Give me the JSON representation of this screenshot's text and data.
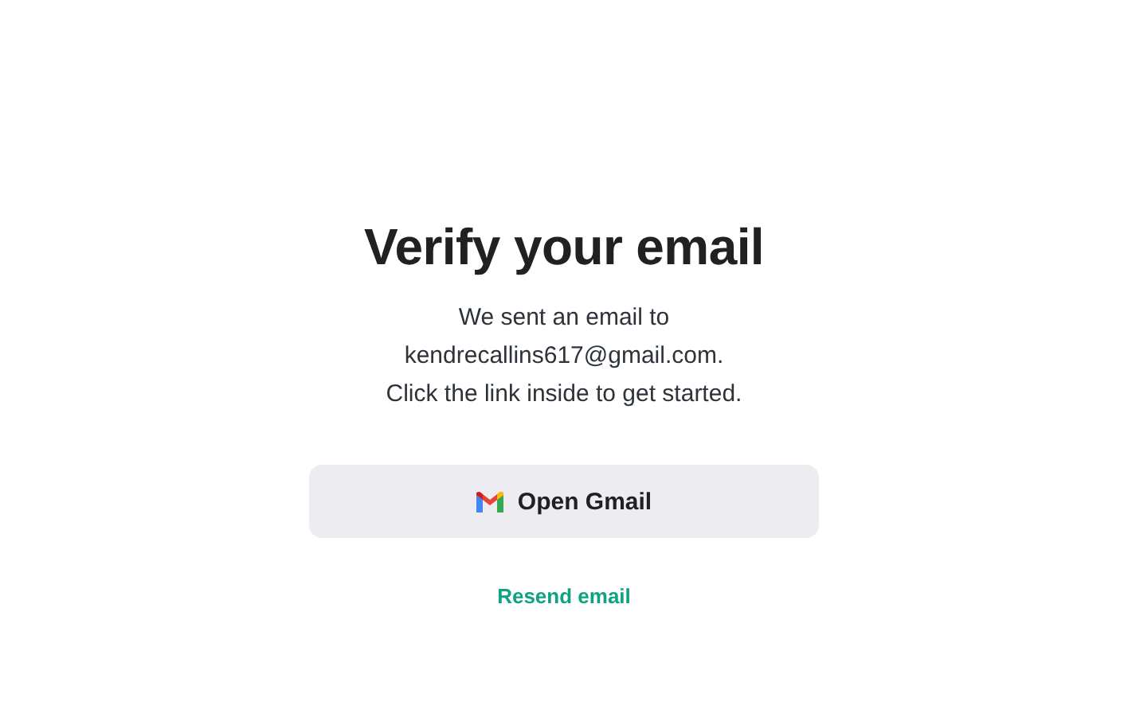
{
  "title": "Verify your email",
  "message_lines": [
    "We sent an email to",
    "kendrecallins617@gmail.com.",
    "Click the link inside to get started."
  ],
  "primary_button": {
    "label": "Open Gmail"
  },
  "link": {
    "label": "Resend email"
  }
}
